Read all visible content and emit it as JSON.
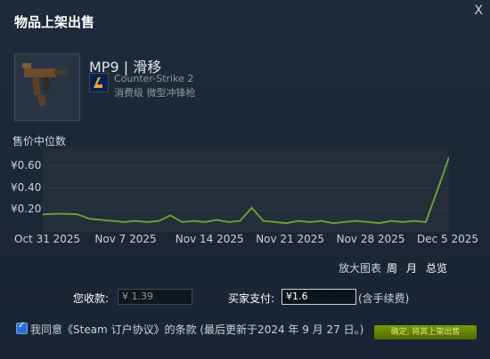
{
  "dialog": {
    "title": "物品上架出售",
    "close_label": "X"
  },
  "item": {
    "name": "MP9 | 滑移",
    "game": "Counter-Strike 2",
    "type": "消费级 微型冲锋枪"
  },
  "chart_section": {
    "title": "售价中位数",
    "zoom_label": "放大图表",
    "zoom_options": [
      "周",
      "月",
      "总览"
    ]
  },
  "chart_data": {
    "type": "line",
    "title": "售价中位数",
    "x_tick_labels": [
      "Oct 31 2025",
      "Nov 7 2025",
      "Nov 14 2025",
      "Nov 21 2025",
      "Nov 28 2025",
      "Dec 5 2025"
    ],
    "y_tick_labels": [
      "¥0.60",
      "¥0.40",
      "¥0.20"
    ],
    "y_ticks": [
      0.6,
      0.4,
      0.2
    ],
    "ylim": [
      0.0,
      0.76
    ],
    "x_range_days": [
      0,
      35
    ],
    "series": [
      {
        "values": [
          [
            0,
            0.16
          ],
          [
            1,
            0.165
          ],
          [
            2,
            0.165
          ],
          [
            3,
            0.16
          ],
          [
            4,
            0.12
          ],
          [
            5,
            0.11
          ],
          [
            6,
            0.1
          ],
          [
            7,
            0.09
          ],
          [
            8,
            0.1
          ],
          [
            9,
            0.09
          ],
          [
            10,
            0.1
          ],
          [
            11,
            0.15
          ],
          [
            12,
            0.09
          ],
          [
            13,
            0.1
          ],
          [
            14,
            0.09
          ],
          [
            15,
            0.11
          ],
          [
            16,
            0.09
          ],
          [
            17,
            0.1
          ],
          [
            18,
            0.22
          ],
          [
            19,
            0.1
          ],
          [
            20,
            0.09
          ],
          [
            21,
            0.08
          ],
          [
            22,
            0.1
          ],
          [
            23,
            0.09
          ],
          [
            24,
            0.1
          ],
          [
            25,
            0.08
          ],
          [
            26,
            0.09
          ],
          [
            27,
            0.1
          ],
          [
            28,
            0.09
          ],
          [
            29,
            0.08
          ],
          [
            30,
            0.1
          ],
          [
            31,
            0.09
          ],
          [
            32,
            0.1
          ],
          [
            33,
            0.09
          ],
          [
            34,
            0.38
          ],
          [
            35,
            0.68
          ]
        ]
      }
    ],
    "colors": {
      "line": "#6b9b3a",
      "plot_bg": "#242d38"
    }
  },
  "payment": {
    "receive_label": "您收款:",
    "receive_value": "¥ 1.39",
    "pay_label": "买家支付:",
    "pay_value": "¥1.6",
    "pay_note": "(含手续费)"
  },
  "agreement": {
    "text": "我同意《Steam 订户协议》的条款 (最后更新于2024 年 9 月 27 日。)",
    "checked": true
  },
  "confirm_button": "确定, 将其上架出售"
}
